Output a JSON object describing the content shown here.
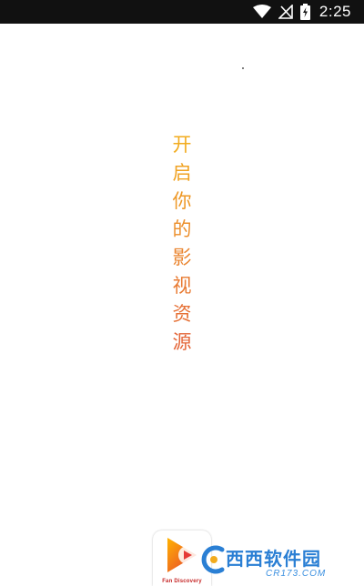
{
  "status_bar": {
    "time": "2:25",
    "icons": [
      "wifi-icon",
      "no-signal-icon",
      "battery-charging-icon"
    ]
  },
  "splash": {
    "slogan_chars": [
      "开",
      "启",
      "你",
      "的",
      "影",
      "视",
      "资",
      "源"
    ],
    "colors": [
      "#f2ab1d",
      "#f0a222",
      "#ee9826",
      "#ec8e2a",
      "#ea842e",
      "#e87a31",
      "#e67035",
      "#e46638"
    ]
  },
  "app_logo": {
    "icon": "play-logo-icon",
    "caption": "Fan Discovery"
  },
  "watermark": {
    "primary": "西西软件园",
    "secondary": "CR173.COM",
    "icon": "cr-logo-icon",
    "color": "#2a7fd4"
  }
}
